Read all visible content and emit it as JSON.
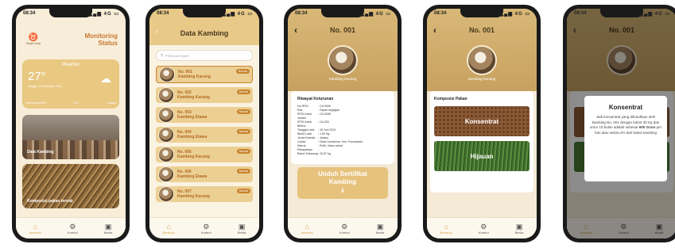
{
  "status_time": "08:34",
  "status_network": "4G",
  "nav": {
    "home": "Beranda",
    "control": "Kontrol",
    "news": "Berita"
  },
  "screen1": {
    "logo_text": "Smart Goat",
    "title_line1": "Monitoring",
    "title_line2": "Status",
    "weather_label": "Weather",
    "temperature": "27°",
    "date": "Minggu, 19 Desember 2021",
    "stats": [
      "Kelembapan 85%",
      "23 C",
      "Cahaya"
    ],
    "card1": "Data Kambing",
    "card2": "Komposisi pakan ternak"
  },
  "screen2": {
    "title": "Data Kambing",
    "search_placeholder": "Find your goat",
    "badge": "Normal",
    "goats": [
      {
        "no": "No. 001",
        "breed": "Kambing Kacang"
      },
      {
        "no": "No. 002",
        "breed": "Kambing Kacang"
      },
      {
        "no": "No. 003",
        "breed": "Kambing Etawa"
      },
      {
        "no": "No. 004",
        "breed": "Kambing Etawa"
      },
      {
        "no": "No. 005",
        "breed": "Kambing Kacang"
      },
      {
        "no": "No. 006",
        "breed": "Kambing Etawa"
      },
      {
        "no": "No. 007",
        "breed": "Kambing Kacang"
      }
    ]
  },
  "screen3": {
    "title": "No. 001",
    "subtitle": "Kambing Kacang",
    "section": "Riwayat Keturunan",
    "rows": [
      {
        "k": "No RFID",
        "v": ": CA 9008"
      },
      {
        "k": "Ras",
        "v": ": Papan segagas"
      },
      {
        "k": "RFID Induk Jantan",
        "v": ": CA 0008"
      },
      {
        "k": "RFID Induk Betina",
        "v": ": CA 200"
      },
      {
        "k": "Tanggal Lahir",
        "v": ": 16 Juni 2021"
      },
      {
        "k": "Bobot Lahir",
        "v": ": 1,50 Kg"
      },
      {
        "k": "Jenis Kelamin",
        "v": ": Jantan"
      },
      {
        "k": "Lokasi",
        "v": ": Desa Sumberan, Kec. Purwokarto"
      },
      {
        "k": "Warna",
        "v": ": Putih, hitam pekat"
      },
      {
        "k": "Riwayatnya",
        "v": ":"
      },
      {
        "k": "Bobot Sekarang",
        "v": ": 20,87 kg"
      }
    ],
    "button": "Unduh Sertifikat Kambing"
  },
  "screen4": {
    "title": "No. 001",
    "subtitle": "Kambing Kacang",
    "section": "Komposisi Pakan",
    "feed1": "Konsentrat",
    "feed2": "Hijauan"
  },
  "screen5": {
    "title": "No. 001",
    "modal_title": "Konsentrat",
    "modal_text_1": "Jadi konsentrat yang dibutuhkan oleh kambing No. 001 dengan bobot 30 Kg dan umur 10 bulan adalah sebesar",
    "modal_bold": "600 Gram",
    "modal_text_2": "per hari atau sekira 2% dari bobot kambing"
  },
  "colors": {
    "gold": "#e8c987",
    "accent": "#d6a24a",
    "brown": "#8a5a2b",
    "badge": "#c8842f"
  }
}
